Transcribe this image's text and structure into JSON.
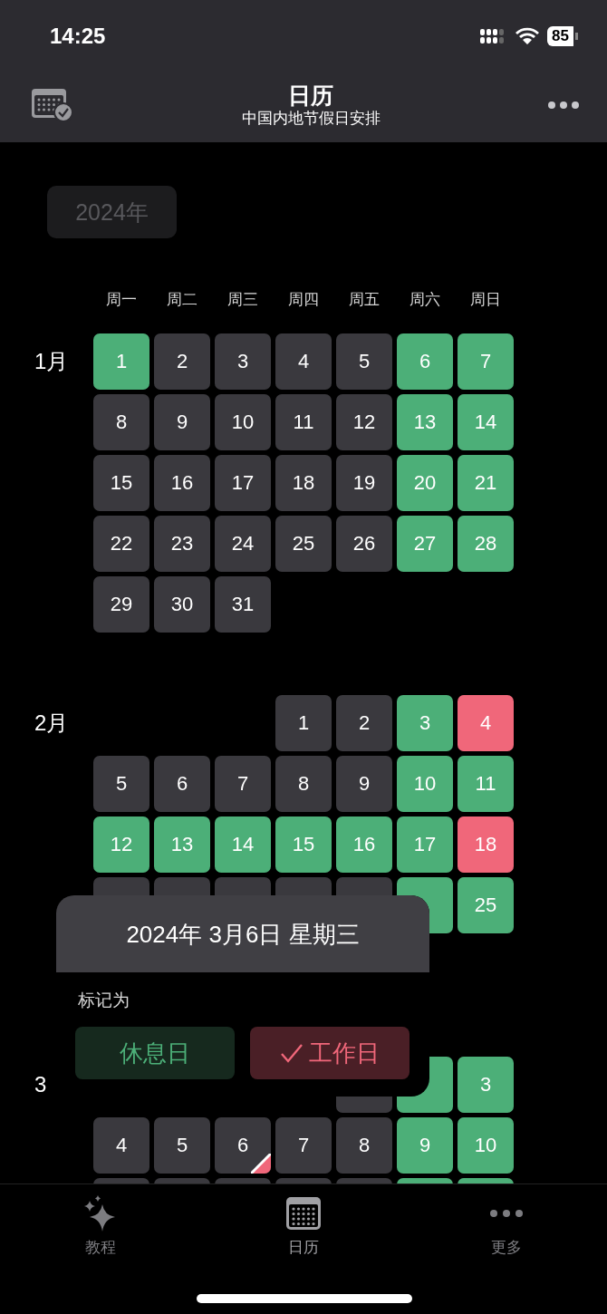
{
  "status_bar": {
    "time": "14:25",
    "battery": "85"
  },
  "header": {
    "title": "日历",
    "subtitle": "中国内地节假日安排"
  },
  "year_button": "2024年",
  "weekdays": [
    "周一",
    "周二",
    "周三",
    "周四",
    "周五",
    "周六",
    "周日"
  ],
  "months": [
    {
      "label": "1月",
      "weeks": [
        [
          {
            "kind": "rest",
            "text": "1"
          },
          {
            "kind": "normal",
            "text": "2"
          },
          {
            "kind": "normal",
            "text": "3"
          },
          {
            "kind": "normal",
            "text": "4"
          },
          {
            "kind": "normal",
            "text": "5"
          },
          {
            "kind": "rest",
            "text": "6"
          },
          {
            "kind": "rest",
            "text": "7"
          }
        ],
        [
          {
            "kind": "normal",
            "text": "8"
          },
          {
            "kind": "normal",
            "text": "9"
          },
          {
            "kind": "normal",
            "text": "10"
          },
          {
            "kind": "normal",
            "text": "11"
          },
          {
            "kind": "normal",
            "text": "12"
          },
          {
            "kind": "rest",
            "text": "13"
          },
          {
            "kind": "rest",
            "text": "14"
          }
        ],
        [
          {
            "kind": "normal",
            "text": "15"
          },
          {
            "kind": "normal",
            "text": "16"
          },
          {
            "kind": "normal",
            "text": "17"
          },
          {
            "kind": "normal",
            "text": "18"
          },
          {
            "kind": "normal",
            "text": "19"
          },
          {
            "kind": "rest",
            "text": "20"
          },
          {
            "kind": "rest",
            "text": "21"
          }
        ],
        [
          {
            "kind": "normal",
            "text": "22"
          },
          {
            "kind": "normal",
            "text": "23"
          },
          {
            "kind": "normal",
            "text": "24"
          },
          {
            "kind": "normal",
            "text": "25"
          },
          {
            "kind": "normal",
            "text": "26"
          },
          {
            "kind": "rest",
            "text": "27"
          },
          {
            "kind": "rest",
            "text": "28"
          }
        ],
        [
          {
            "kind": "normal",
            "text": "29"
          },
          {
            "kind": "normal",
            "text": "30"
          },
          {
            "kind": "normal",
            "text": "31"
          }
        ]
      ]
    },
    {
      "label": "2月",
      "weeks": [
        [
          {
            "kind": "blank"
          },
          {
            "kind": "blank"
          },
          {
            "kind": "blank"
          },
          {
            "kind": "normal",
            "text": "1"
          },
          {
            "kind": "normal",
            "text": "2"
          },
          {
            "kind": "rest",
            "text": "3"
          },
          {
            "kind": "work",
            "text": "4"
          }
        ],
        [
          {
            "kind": "normal",
            "text": "5"
          },
          {
            "kind": "normal",
            "text": "6"
          },
          {
            "kind": "normal",
            "text": "7"
          },
          {
            "kind": "normal",
            "text": "8"
          },
          {
            "kind": "normal",
            "text": "9"
          },
          {
            "kind": "rest",
            "text": "10"
          },
          {
            "kind": "rest",
            "text": "11"
          }
        ],
        [
          {
            "kind": "rest",
            "text": "12"
          },
          {
            "kind": "rest",
            "text": "13"
          },
          {
            "kind": "rest",
            "text": "14"
          },
          {
            "kind": "rest",
            "text": "15"
          },
          {
            "kind": "rest",
            "text": "16"
          },
          {
            "kind": "rest",
            "text": "17"
          },
          {
            "kind": "work",
            "text": "18"
          }
        ],
        [
          {
            "kind": "normal"
          },
          {
            "kind": "normal"
          },
          {
            "kind": "normal"
          },
          {
            "kind": "normal"
          },
          {
            "kind": "normal"
          },
          {
            "kind": "rest"
          },
          {
            "kind": "rest",
            "text": "25"
          }
        ]
      ]
    },
    {
      "label": "3",
      "weeks": [
        [
          {
            "kind": "blank"
          },
          {
            "kind": "blank"
          },
          {
            "kind": "blank"
          },
          {
            "kind": "blank"
          },
          {
            "kind": "normal"
          },
          {
            "kind": "rest"
          },
          {
            "kind": "rest",
            "text": "3"
          }
        ],
        [
          {
            "kind": "normal",
            "text": "4"
          },
          {
            "kind": "normal",
            "text": "5"
          },
          {
            "kind": "flagged",
            "text": "6"
          },
          {
            "kind": "normal",
            "text": "7"
          },
          {
            "kind": "normal",
            "text": "8"
          },
          {
            "kind": "rest",
            "text": "9"
          },
          {
            "kind": "rest",
            "text": "10"
          }
        ],
        [
          {
            "kind": "normal"
          },
          {
            "kind": "normal"
          },
          {
            "kind": "normal"
          },
          {
            "kind": "normal"
          },
          {
            "kind": "normal"
          },
          {
            "kind": "rest"
          },
          {
            "kind": "rest"
          }
        ]
      ]
    }
  ],
  "popup": {
    "date": "2024年 3月6日 星期三",
    "prompt": "标记为",
    "options": [
      {
        "label": "休息日",
        "kind": "rest",
        "selected": false
      },
      {
        "label": "工作日",
        "kind": "work",
        "selected": true
      }
    ]
  },
  "tab_bar": [
    {
      "label": "教程",
      "kind": "sparkles",
      "selected": false
    },
    {
      "label": "日历",
      "kind": "calendar",
      "selected": true
    },
    {
      "label": "更多",
      "kind": "more",
      "selected": false
    }
  ]
}
